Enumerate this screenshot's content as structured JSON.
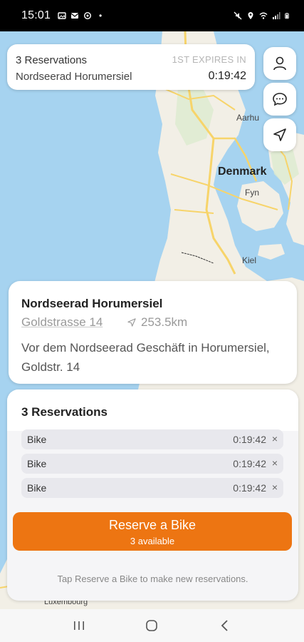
{
  "status_bar": {
    "time": "15:01"
  },
  "map": {
    "labels": {
      "denmark": "Denmark",
      "aarhus": "Aarhu",
      "fyn": "Fyn",
      "kiel": "Kiel",
      "luxembourg": "Luxembourg"
    }
  },
  "top_card": {
    "title": "3 Reservations",
    "station": "Nordseerad Horumersiel",
    "expires_label": "1ST EXPIRES IN",
    "timer": "0:19:42"
  },
  "station_card": {
    "name": "Nordseerad Horumersiel",
    "address": "Goldstrasse 14",
    "distance": "253.5km",
    "description": "Vor dem Nordseerad Geschäft in Horumersiel, Goldstr. 14"
  },
  "reservations": {
    "title": "3 Reservations",
    "items": [
      {
        "label": "Bike",
        "time": "0:19:42",
        "close": "×"
      },
      {
        "label": "Bike",
        "time": "0:19:42",
        "close": "×"
      },
      {
        "label": "Bike",
        "time": "0:19:42",
        "close": "×"
      }
    ],
    "button_label": "Reserve a Bike",
    "button_sub": "3 available",
    "hint": "Tap Reserve a Bike to make new reservations."
  },
  "colors": {
    "accent": "#ed7512",
    "sea": "#a6d3f0",
    "land": "#f2efe6",
    "road": "#f7d46a"
  },
  "icons": {
    "profile": "user-icon",
    "chat": "chat-bubble-icon",
    "locate": "navigation-arrow-icon",
    "distance": "navigation-arrow-icon"
  }
}
